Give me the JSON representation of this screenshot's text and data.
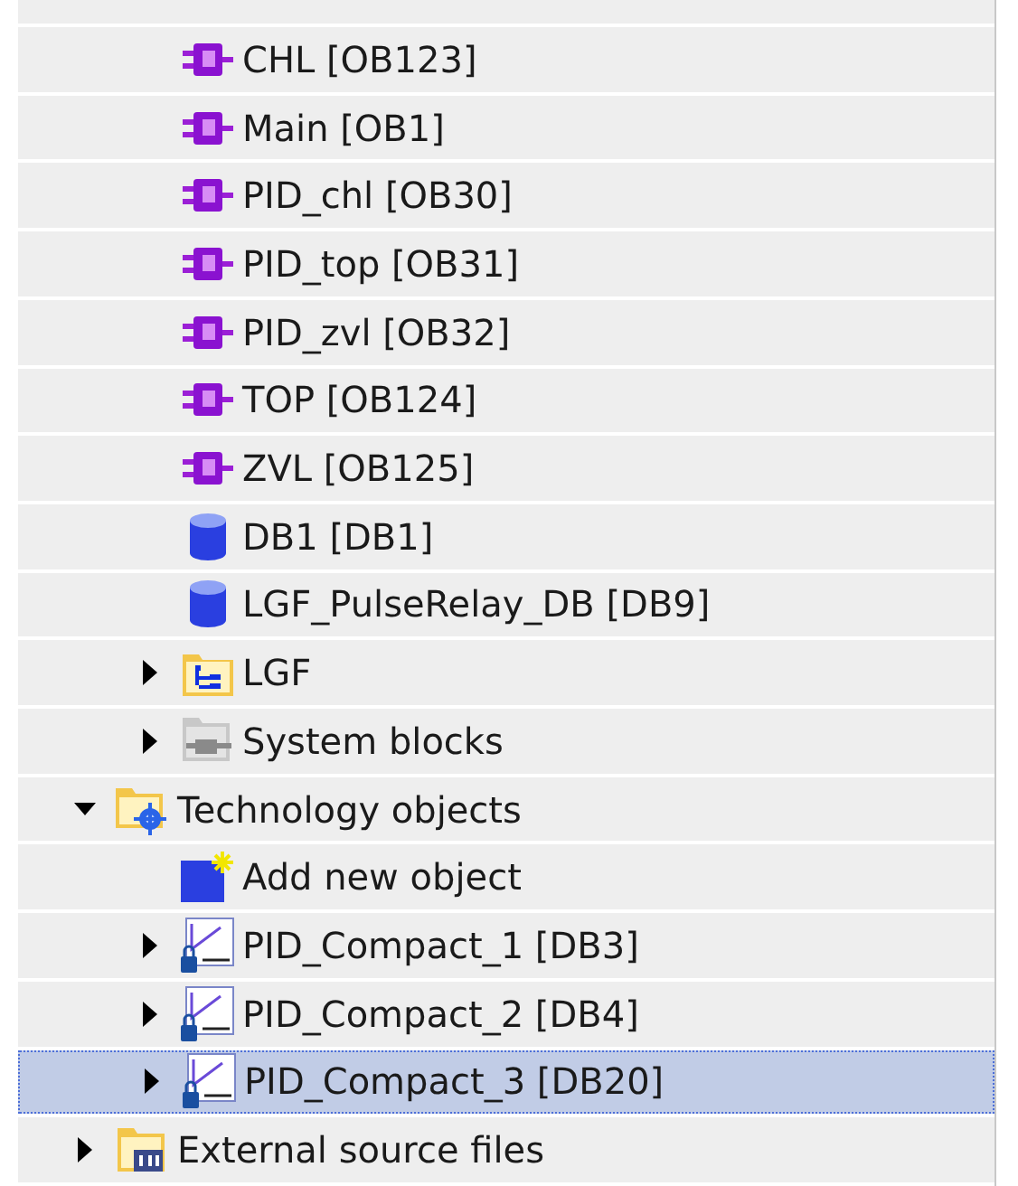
{
  "tree": [
    {
      "children": [
        {
          "label": "CHL [OB123]",
          "kind": "ob",
          "selected": false
        },
        {
          "label": "Main [OB1]",
          "kind": "ob",
          "selected": false
        },
        {
          "label": "PID_chl [OB30]",
          "kind": "ob",
          "selected": false
        },
        {
          "label": "PID_top [OB31]",
          "kind": "ob",
          "selected": false
        },
        {
          "label": "PID_zvl [OB32]",
          "kind": "ob",
          "selected": false
        },
        {
          "label": "TOP [OB124]",
          "kind": "ob",
          "selected": false
        },
        {
          "label": "ZVL [OB125]",
          "kind": "ob",
          "selected": false
        },
        {
          "label": "DB1 [DB1]",
          "kind": "db",
          "selected": false
        },
        {
          "label": "LGF_PulseRelay_DB [DB9]",
          "kind": "db",
          "selected": false
        },
        {
          "label": "LGF",
          "kind": "group",
          "expanded": false,
          "selected": false
        },
        {
          "label": "System blocks",
          "kind": "system",
          "expanded": false,
          "selected": false
        }
      ]
    },
    {
      "label": "Technology objects",
      "kind": "technology",
      "expanded": true,
      "selected": false,
      "children": [
        {
          "label": "Add new object",
          "kind": "add",
          "selected": false
        },
        {
          "label": "PID_Compact_1 [DB3]",
          "kind": "pid",
          "expanded": false,
          "selected": false
        },
        {
          "label": "PID_Compact_2 [DB4]",
          "kind": "pid",
          "expanded": false,
          "selected": false
        },
        {
          "label": "PID_Compact_3 [DB20]",
          "kind": "pid",
          "expanded": false,
          "selected": true
        }
      ]
    },
    {
      "label": "External source files",
      "kind": "source",
      "expanded": false,
      "selected": false
    }
  ]
}
